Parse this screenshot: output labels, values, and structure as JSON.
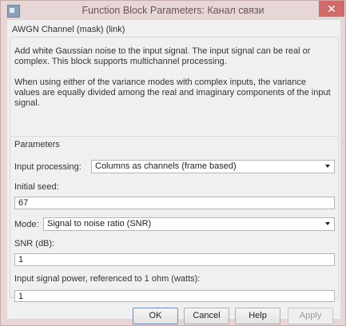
{
  "window": {
    "title": "Function Block Parameters: Канал связи",
    "close_glyph": "✕"
  },
  "mask_title": "AWGN Channel (mask) (link)",
  "description": [
    "Add white Gaussian noise to the input signal. The input signal can be real or",
    "complex. This block supports multichannel processing.",
    "When using either of the variance modes with complex inputs, the variance",
    "values are equally divided among the real and imaginary components of the input",
    "signal."
  ],
  "parameters": {
    "group_title": "Parameters",
    "input_processing": {
      "label": "Input processing:",
      "value": "Columns as channels (frame based)"
    },
    "initial_seed": {
      "label": "Initial seed:",
      "value": "67"
    },
    "mode": {
      "label": "Mode:",
      "value": "Signal to noise ratio  (SNR)"
    },
    "snr": {
      "label": "SNR (dB):",
      "value": "1"
    },
    "input_power": {
      "label": "Input signal power, referenced to 1 ohm (watts):",
      "value": "1"
    }
  },
  "buttons": {
    "ok": "OK",
    "cancel": "Cancel",
    "help": "Help",
    "apply": "Apply"
  },
  "icons": {
    "app": "simulink-window-icon",
    "dropdown": "chevron-down-icon"
  },
  "colors": {
    "frame": "#e6d6d6",
    "close_button": "#cf6b6b",
    "client": "#f0f0f0",
    "default_button_border": "#5a8fd0"
  }
}
